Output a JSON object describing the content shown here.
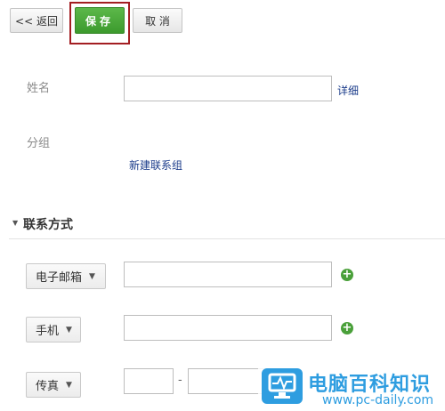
{
  "toolbar": {
    "back_label": "<< 返回",
    "save_label": "保存",
    "cancel_label": "取 消"
  },
  "form": {
    "name": {
      "label": "姓名",
      "value": "",
      "details_link": "详细"
    },
    "group": {
      "label": "分组",
      "new_group_link": "新建联系组"
    }
  },
  "contact_section": {
    "title": "联系方式",
    "rows": [
      {
        "type_label": "电子邮箱",
        "value": ""
      },
      {
        "type_label": "手机",
        "value": ""
      },
      {
        "type_label": "传真",
        "area_code": "",
        "number": ""
      }
    ],
    "fax_separator": "-"
  },
  "watermark": {
    "title": "电脑百科知识",
    "url": "www.pc-daily.com"
  },
  "colors": {
    "save_green": "#4aa63a",
    "highlight_red": "#a31e22",
    "link_blue": "#1a3b8a",
    "watermark_blue": "#2e9de0"
  }
}
